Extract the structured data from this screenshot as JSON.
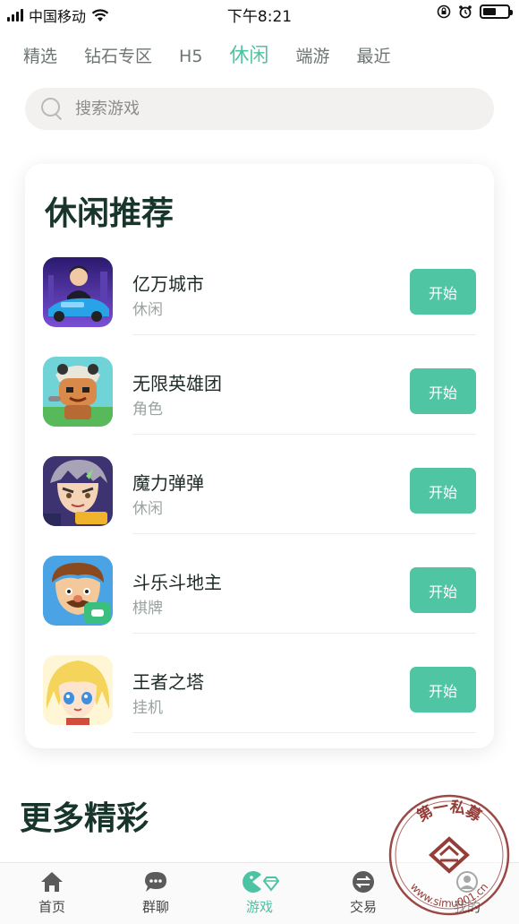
{
  "status_bar": {
    "carrier": "中国移动",
    "time": "下午8:21"
  },
  "tabs": [
    {
      "label": "精选"
    },
    {
      "label": "钻石专区"
    },
    {
      "label": "H5"
    },
    {
      "label": "休闲",
      "active": true
    },
    {
      "label": "端游"
    },
    {
      "label": "最近"
    }
  ],
  "search": {
    "placeholder": "搜索游戏"
  },
  "recommend": {
    "title": "休闲推荐",
    "games": [
      {
        "name": "亿万城市",
        "tag": "休闲",
        "button": "开始",
        "icon": "city-racing-game-icon"
      },
      {
        "name": "无限英雄团",
        "tag": "角色",
        "button": "开始",
        "icon": "hero-squad-game-icon"
      },
      {
        "name": "魔力弹弹",
        "tag": "休闲",
        "button": "开始",
        "icon": "magic-bounce-game-icon"
      },
      {
        "name": "斗乐斗地主",
        "tag": "棋牌",
        "button": "开始",
        "icon": "card-game-icon"
      },
      {
        "name": "王者之塔",
        "tag": "挂机",
        "button": "开始",
        "icon": "tower-king-game-icon"
      }
    ]
  },
  "more_section": {
    "title": "更多精彩"
  },
  "bottom_nav": [
    {
      "label": "首页",
      "icon": "home-icon"
    },
    {
      "label": "群聊",
      "icon": "chat-bubble-icon"
    },
    {
      "label": "游戏",
      "icon": "game-pacman-icon",
      "active": true
    },
    {
      "label": "交易",
      "icon": "exchange-icon"
    },
    {
      "label": "我的",
      "icon": "user-icon"
    }
  ],
  "watermark": {
    "top_text": "第一私募",
    "bottom_text": "www.simu001.cn"
  },
  "colors": {
    "accent": "#4fc5a4",
    "title": "#17352a",
    "muted": "#9aa39f"
  }
}
